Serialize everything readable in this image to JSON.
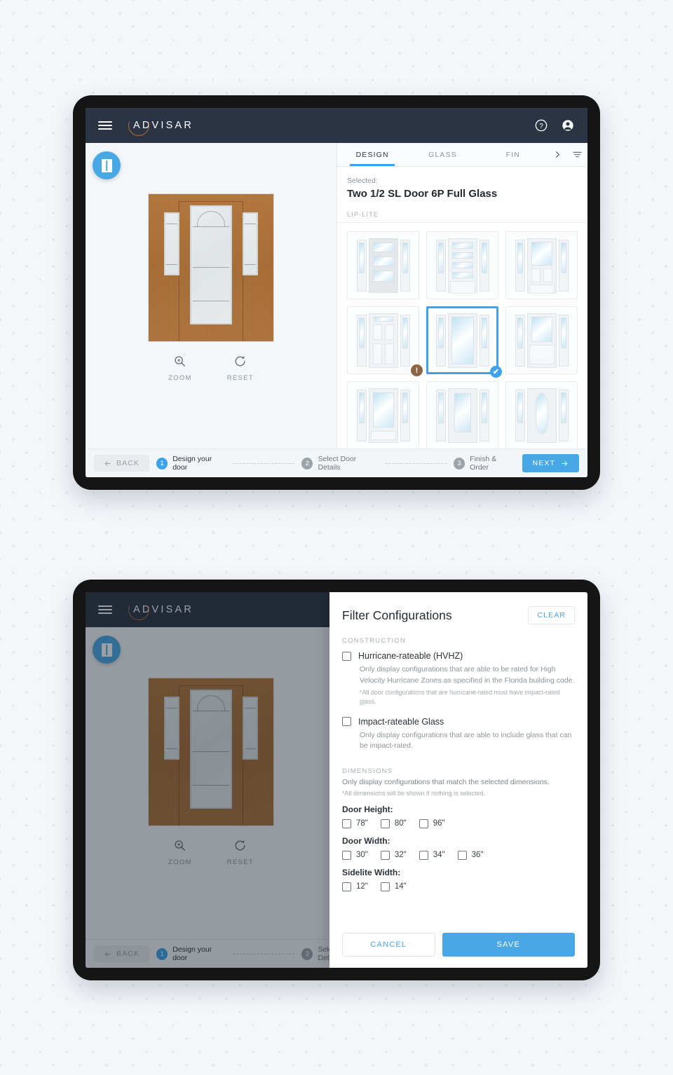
{
  "header": {
    "brand": "ADVISAR",
    "menu_icon": "hamburger-icon",
    "help_icon": "help-circle-icon",
    "account_icon": "account-circle-icon"
  },
  "preview": {
    "toggle_icon": "door-panel-icon",
    "zoom_label": "ZOOM",
    "reset_label": "RESET"
  },
  "config": {
    "tabs": [
      {
        "label": "DESIGN",
        "active": true
      },
      {
        "label": "GLASS",
        "active": false
      },
      {
        "label": "FIN",
        "active": false
      }
    ],
    "scroll_icon": "chevron-right-icon",
    "filter_icon": "filter-funnel-icon",
    "selected_label": "Selected:",
    "selected_title": "Two 1/2 SL Door 6P Full Glass",
    "group_label": "LIP-LITE",
    "thumbnails": [
      {
        "name": "config-1",
        "selected": false,
        "badge": ""
      },
      {
        "name": "config-2",
        "selected": false,
        "badge": ""
      },
      {
        "name": "config-3",
        "selected": false,
        "badge": ""
      },
      {
        "name": "config-4",
        "selected": false,
        "badge": "warning"
      },
      {
        "name": "config-5",
        "selected": true,
        "badge": "check"
      },
      {
        "name": "config-6",
        "selected": false,
        "badge": ""
      },
      {
        "name": "config-7",
        "selected": false,
        "badge": ""
      },
      {
        "name": "config-8",
        "selected": false,
        "badge": ""
      },
      {
        "name": "config-9",
        "selected": false,
        "badge": ""
      }
    ],
    "warning_glyph": "!",
    "check_glyph": "✔"
  },
  "stepper": {
    "back_label": "BACK",
    "next_label": "NEXT",
    "steps": [
      {
        "num": "1",
        "label": "Design your door",
        "active": true
      },
      {
        "num": "2",
        "label": "Select Door Details",
        "active": false
      },
      {
        "num": "3",
        "label": "Finish & Order",
        "active": false
      }
    ]
  },
  "filter": {
    "title": "Filter Configurations",
    "clear_label": "CLEAR",
    "construction_label": "CONSTRUCTION",
    "hurricane": {
      "label": "Hurricane-rateable (HVHZ)",
      "desc": "Only display configurations that are able to be rated for High Velocity Hurricane Zones as specified in the Florida building code.",
      "note": "*All door configurations that are hurricane-rated must have impact-rated glass."
    },
    "impact": {
      "label": "Impact-rateable Glass",
      "desc": "Only display configurations that are able to include glass that can be impact-rated."
    },
    "dimensions_label": "DIMENSIONS",
    "dimensions_desc": "Only display configurations that match the selected dimensions.",
    "dimensions_note": "*All dimensions will be shown if nothing is selected.",
    "door_height": {
      "title": "Door Height:",
      "options": [
        "78\"",
        "80\"",
        "96\""
      ]
    },
    "door_width": {
      "title": "Door Width:",
      "options": [
        "30\"",
        "32\"",
        "34\"",
        "36\""
      ]
    },
    "sidelite_width": {
      "title": "Sidelite Width:",
      "options": [
        "12\"",
        "14\""
      ]
    },
    "cancel_label": "CANCEL",
    "save_label": "SAVE"
  },
  "colors": {
    "accent": "#47a8e5",
    "header_bg": "#2b3444",
    "brand_ring": "#b4683a",
    "warning": "#8d6544",
    "page_bg": "#f4f7fa"
  }
}
